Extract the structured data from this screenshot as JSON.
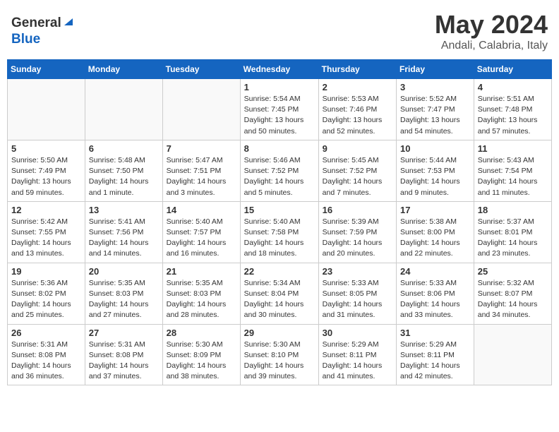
{
  "header": {
    "logo_general": "General",
    "logo_blue": "Blue",
    "month": "May 2024",
    "location": "Andali, Calabria, Italy"
  },
  "weekdays": [
    "Sunday",
    "Monday",
    "Tuesday",
    "Wednesday",
    "Thursday",
    "Friday",
    "Saturday"
  ],
  "weeks": [
    [
      {
        "day": "",
        "info": ""
      },
      {
        "day": "",
        "info": ""
      },
      {
        "day": "",
        "info": ""
      },
      {
        "day": "1",
        "info": "Sunrise: 5:54 AM\nSunset: 7:45 PM\nDaylight: 13 hours\nand 50 minutes."
      },
      {
        "day": "2",
        "info": "Sunrise: 5:53 AM\nSunset: 7:46 PM\nDaylight: 13 hours\nand 52 minutes."
      },
      {
        "day": "3",
        "info": "Sunrise: 5:52 AM\nSunset: 7:47 PM\nDaylight: 13 hours\nand 54 minutes."
      },
      {
        "day": "4",
        "info": "Sunrise: 5:51 AM\nSunset: 7:48 PM\nDaylight: 13 hours\nand 57 minutes."
      }
    ],
    [
      {
        "day": "5",
        "info": "Sunrise: 5:50 AM\nSunset: 7:49 PM\nDaylight: 13 hours\nand 59 minutes."
      },
      {
        "day": "6",
        "info": "Sunrise: 5:48 AM\nSunset: 7:50 PM\nDaylight: 14 hours\nand 1 minute."
      },
      {
        "day": "7",
        "info": "Sunrise: 5:47 AM\nSunset: 7:51 PM\nDaylight: 14 hours\nand 3 minutes."
      },
      {
        "day": "8",
        "info": "Sunrise: 5:46 AM\nSunset: 7:52 PM\nDaylight: 14 hours\nand 5 minutes."
      },
      {
        "day": "9",
        "info": "Sunrise: 5:45 AM\nSunset: 7:52 PM\nDaylight: 14 hours\nand 7 minutes."
      },
      {
        "day": "10",
        "info": "Sunrise: 5:44 AM\nSunset: 7:53 PM\nDaylight: 14 hours\nand 9 minutes."
      },
      {
        "day": "11",
        "info": "Sunrise: 5:43 AM\nSunset: 7:54 PM\nDaylight: 14 hours\nand 11 minutes."
      }
    ],
    [
      {
        "day": "12",
        "info": "Sunrise: 5:42 AM\nSunset: 7:55 PM\nDaylight: 14 hours\nand 13 minutes."
      },
      {
        "day": "13",
        "info": "Sunrise: 5:41 AM\nSunset: 7:56 PM\nDaylight: 14 hours\nand 14 minutes."
      },
      {
        "day": "14",
        "info": "Sunrise: 5:40 AM\nSunset: 7:57 PM\nDaylight: 14 hours\nand 16 minutes."
      },
      {
        "day": "15",
        "info": "Sunrise: 5:40 AM\nSunset: 7:58 PM\nDaylight: 14 hours\nand 18 minutes."
      },
      {
        "day": "16",
        "info": "Sunrise: 5:39 AM\nSunset: 7:59 PM\nDaylight: 14 hours\nand 20 minutes."
      },
      {
        "day": "17",
        "info": "Sunrise: 5:38 AM\nSunset: 8:00 PM\nDaylight: 14 hours\nand 22 minutes."
      },
      {
        "day": "18",
        "info": "Sunrise: 5:37 AM\nSunset: 8:01 PM\nDaylight: 14 hours\nand 23 minutes."
      }
    ],
    [
      {
        "day": "19",
        "info": "Sunrise: 5:36 AM\nSunset: 8:02 PM\nDaylight: 14 hours\nand 25 minutes."
      },
      {
        "day": "20",
        "info": "Sunrise: 5:35 AM\nSunset: 8:03 PM\nDaylight: 14 hours\nand 27 minutes."
      },
      {
        "day": "21",
        "info": "Sunrise: 5:35 AM\nSunset: 8:03 PM\nDaylight: 14 hours\nand 28 minutes."
      },
      {
        "day": "22",
        "info": "Sunrise: 5:34 AM\nSunset: 8:04 PM\nDaylight: 14 hours\nand 30 minutes."
      },
      {
        "day": "23",
        "info": "Sunrise: 5:33 AM\nSunset: 8:05 PM\nDaylight: 14 hours\nand 31 minutes."
      },
      {
        "day": "24",
        "info": "Sunrise: 5:33 AM\nSunset: 8:06 PM\nDaylight: 14 hours\nand 33 minutes."
      },
      {
        "day": "25",
        "info": "Sunrise: 5:32 AM\nSunset: 8:07 PM\nDaylight: 14 hours\nand 34 minutes."
      }
    ],
    [
      {
        "day": "26",
        "info": "Sunrise: 5:31 AM\nSunset: 8:08 PM\nDaylight: 14 hours\nand 36 minutes."
      },
      {
        "day": "27",
        "info": "Sunrise: 5:31 AM\nSunset: 8:08 PM\nDaylight: 14 hours\nand 37 minutes."
      },
      {
        "day": "28",
        "info": "Sunrise: 5:30 AM\nSunset: 8:09 PM\nDaylight: 14 hours\nand 38 minutes."
      },
      {
        "day": "29",
        "info": "Sunrise: 5:30 AM\nSunset: 8:10 PM\nDaylight: 14 hours\nand 39 minutes."
      },
      {
        "day": "30",
        "info": "Sunrise: 5:29 AM\nSunset: 8:11 PM\nDaylight: 14 hours\nand 41 minutes."
      },
      {
        "day": "31",
        "info": "Sunrise: 5:29 AM\nSunset: 8:11 PM\nDaylight: 14 hours\nand 42 minutes."
      },
      {
        "day": "",
        "info": ""
      }
    ]
  ]
}
